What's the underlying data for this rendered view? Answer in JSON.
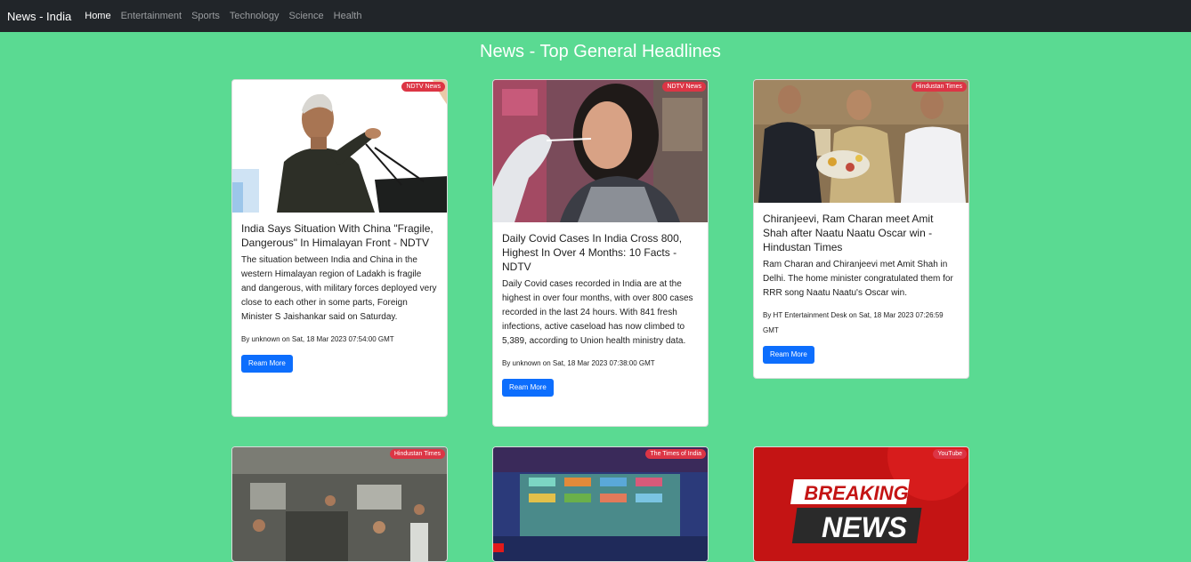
{
  "nav": {
    "brand": "News - India",
    "links": [
      "Home",
      "Entertainment",
      "Sports",
      "Technology",
      "Science",
      "Health"
    ],
    "active": "Home"
  },
  "heading": "News - Top General Headlines",
  "colors": {
    "page_background": "#5ada92",
    "navbar": "#212529",
    "badge": "#dc3545",
    "button": "#0d6efd"
  },
  "articles": [
    {
      "source": "NDTV News",
      "title": "India Says Situation With China \"Fragile, Dangerous\" In Himalayan Front - NDTV",
      "description": "The situation between India and China in the western Himalayan region of Ladakh is fragile and dangerous, with military forces deployed very close to each other in some parts, Foreign Minister S Jaishankar said on Saturday.",
      "byline": "By unknown on Sat, 18 Mar 2023 07:54:00 GMT",
      "button": "Ream More"
    },
    {
      "source": "NDTV News",
      "title": "Daily Covid Cases In India Cross 800, Highest In Over 4 Months: 10 Facts - NDTV",
      "description": "Daily Covid cases recorded in India are at the highest in over four months, with over 800 cases recorded in the last 24 hours. With 841 fresh infections, active caseload has now climbed to 5,389, according to Union health ministry data.",
      "byline": "By unknown on Sat, 18 Mar 2023 07:38:00 GMT",
      "button": "Ream More"
    },
    {
      "source": "Hindustan Times",
      "title": "Chiranjeevi, Ram Charan meet Amit Shah after Naatu Naatu Oscar win - Hindustan Times",
      "description": "Ram Charan and Chiranjeevi met Amit Shah in Delhi. The home minister congratulated them for RRR song Naatu Naatu's Oscar win.",
      "byline": "By HT Entertainment Desk on Sat, 18 Mar 2023 07:26:59 GMT",
      "button": "Ream More"
    },
    {
      "source": "Hindustan Times"
    },
    {
      "source": "The Times of India"
    },
    {
      "source": "YouTube",
      "image_text": [
        "BREAKING",
        "NEWS"
      ]
    }
  ]
}
